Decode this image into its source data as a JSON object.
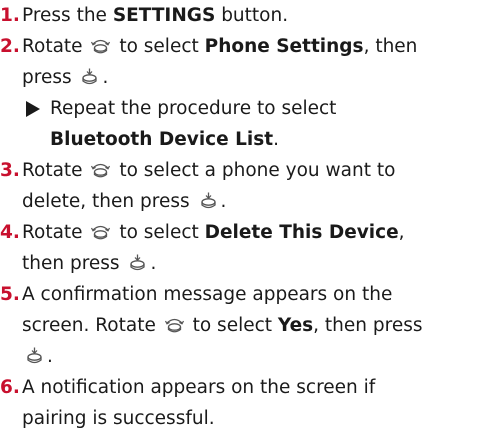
{
  "steps": [
    {
      "num": "1.",
      "t1": "Press the ",
      "b1": "SETTINGS",
      "t2": " button."
    },
    {
      "num": "2.",
      "t1": "Rotate ",
      "t2": " to select ",
      "b1": "Phone Settings",
      "t3": ", then",
      "t4": "press ",
      "t5": ".",
      "sub1": "Repeat the procedure to select",
      "sub2": "Bluetooth Device List",
      "sub3": "."
    },
    {
      "num": "3.",
      "t1": "Rotate ",
      "t2": " to select a phone you want to",
      "t3": "delete, then press ",
      "t4": "."
    },
    {
      "num": "4.",
      "t1": "Rotate ",
      "t2": " to select ",
      "b1": "Delete This Device",
      "t3": ",",
      "t4": "then press ",
      "t5": "."
    },
    {
      "num": "5.",
      "t1": "A confirmation message appears on the",
      "t2": "screen. Rotate ",
      "t3": " to select ",
      "b1": "Yes",
      "t4": ", then press",
      "t5": "."
    },
    {
      "num": "6.",
      "t1": "A notification appears on the screen if",
      "t2": "pairing is successful."
    }
  ],
  "icons": {
    "rotate": "rotate-knob-icon",
    "press": "press-knob-icon"
  }
}
